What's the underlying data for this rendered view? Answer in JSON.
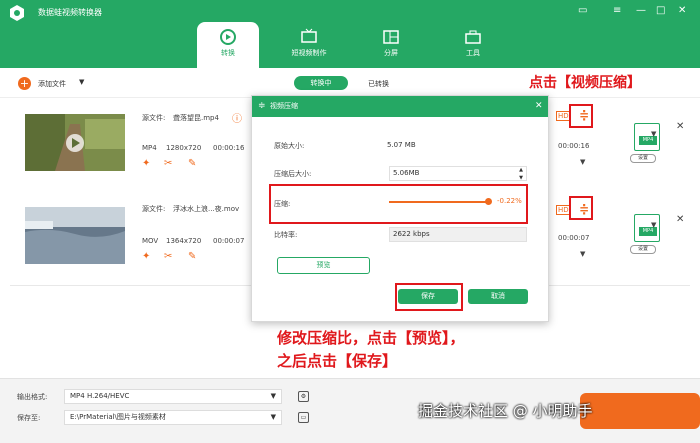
{
  "app": {
    "title": "数据蛙视频转换器"
  },
  "nav": {
    "tabs": [
      {
        "label": "转换"
      },
      {
        "label": "短视频制作"
      },
      {
        "label": "分屏"
      },
      {
        "label": "工具"
      }
    ]
  },
  "toolbar": {
    "add_file": "添加文件",
    "converting": "转换中",
    "converted": "已转换"
  },
  "files": [
    {
      "source_label": "源文件:",
      "filename": "聋落望昆.mp4",
      "format": "MP4",
      "resolution": "1280x720",
      "duration": "00:00:16",
      "out_duration": "00:00:16"
    },
    {
      "source_label": "源文件:",
      "filename": "浮冰水上浪...夜.mov",
      "format": "MOV",
      "resolution": "1364x720",
      "duration": "00:00:07",
      "out_duration": "00:00:07"
    }
  ],
  "output": {
    "format_label": "输出格式:",
    "format_value": "MP4 H.264/HEVC",
    "save_label": "保存至:",
    "save_path": "E:\\PrMaterial\\图片与视频素材"
  },
  "format_card": {
    "badge": "MP4",
    "settings": "设置"
  },
  "modal": {
    "title": "视频压缩",
    "original_size_label": "原始大小:",
    "original_size": "5.07 MB",
    "compressed_size_label": "压缩后大小:",
    "compressed_size": "5.06MB",
    "compress_label": "压缩:",
    "compress_percent": "-0.22%",
    "bitrate_label": "比特率:",
    "bitrate": "2622 kbps",
    "preview": "预览",
    "save": "保存",
    "cancel": "取消"
  },
  "annotations": {
    "click_compress": "点击【视频压缩】",
    "instruction_line1": "修改压缩比，点击【预览】，",
    "instruction_line2": "之后点击【保存】"
  },
  "watermark": "掘金技术社区 @ 小明助手",
  "colors": {
    "brand": "#25a864",
    "accent": "#f06a1e",
    "highlight": "#e0181c"
  }
}
